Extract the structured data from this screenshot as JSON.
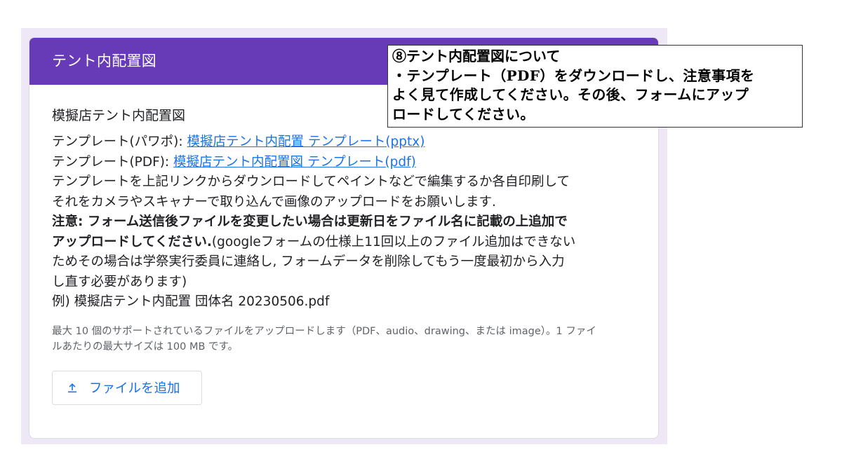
{
  "form": {
    "section_title": "テント内配置図",
    "question_title": "模擬店テント内配置図",
    "description": {
      "template_pptx_prefix": "テンプレート(パワポ): ",
      "template_pptx_link": "模擬店テント内配置 テンプレート(pptx)",
      "template_pdf_prefix": "テンプレート(PDF): ",
      "template_pdf_link": "模擬店テント内配置図 テンプレート(pdf)",
      "instructions_line1": "テンプレートを上記リンクからダウンロードしてペイントなどで編集するか各自印刷して",
      "instructions_line2": "それをカメラやスキャナーで取り込んで画像のアップロードをお願いします.",
      "caution_line1": "注意: フォーム送信後ファイルを変更したい場合は更新日をファイル名に記載の上追加で",
      "caution_line2_bold": "アップロードしてください.",
      "caution_line2_rest": "(googleフォームの仕様上11回以上のファイル追加はできない",
      "caution_line3": "ためその場合は学祭実行委員に連絡し, フォームデータを削除してもう一度最初から入力",
      "caution_line4": "し直す必要があります)",
      "example": "例)  模擬店テント内配置 団体名 20230506.pdf"
    },
    "upload_info": "最大 10 個のサポートされているファイルをアップロードします（PDF、audio、drawing、または image）。1 ファイルあたりの最大サイズは 100 MB です。",
    "add_file_button": "ファイルを追加"
  },
  "annotation": {
    "title": "⑧テント内配置図について",
    "line1": "・テンプレート（PDF）をダウンロードし、注意事項を",
    "line2": "よく見て作成してください。その後、フォームにアップ",
    "line3": "ロードしてください。"
  },
  "colors": {
    "header": "#673ab7",
    "background": "#ede7f6",
    "link": "#1a73e8"
  },
  "icons": {
    "upload": "upload-icon"
  }
}
